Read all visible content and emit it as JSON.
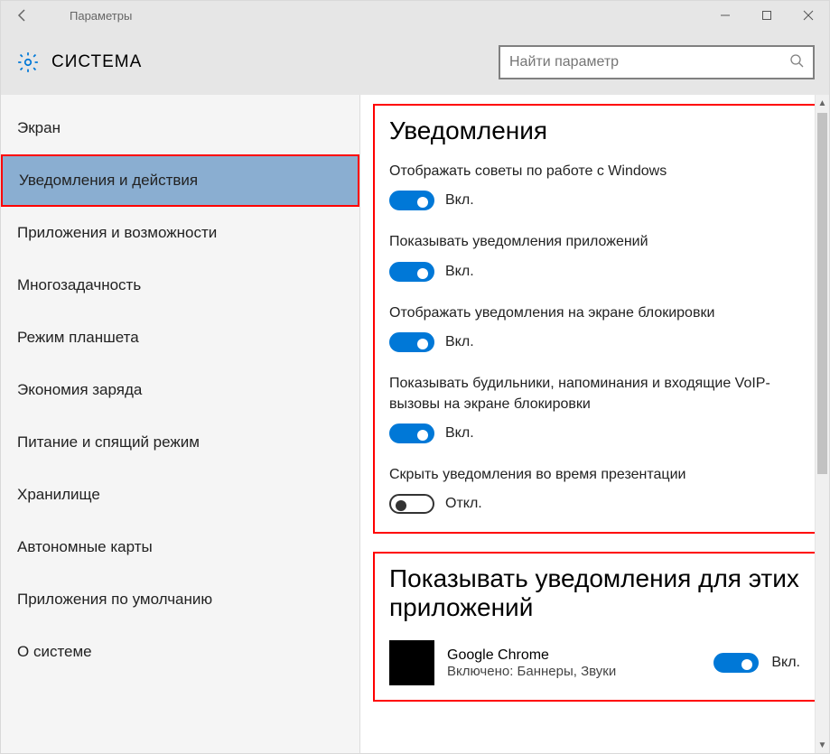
{
  "window": {
    "title": "Параметры"
  },
  "header": {
    "title": "СИСТЕМА",
    "search_placeholder": "Найти параметр"
  },
  "sidebar": {
    "items": [
      {
        "label": "Экран",
        "selected": false
      },
      {
        "label": "Уведомления и действия",
        "selected": true
      },
      {
        "label": "Приложения и возможности",
        "selected": false
      },
      {
        "label": "Многозадачность",
        "selected": false
      },
      {
        "label": "Режим планшета",
        "selected": false
      },
      {
        "label": "Экономия заряда",
        "selected": false
      },
      {
        "label": "Питание и спящий режим",
        "selected": false
      },
      {
        "label": "Хранилище",
        "selected": false
      },
      {
        "label": "Автономные карты",
        "selected": false
      },
      {
        "label": "Приложения по умолчанию",
        "selected": false
      },
      {
        "label": "О системе",
        "selected": false
      }
    ]
  },
  "main": {
    "section1_title": "Уведомления",
    "toggle_on_text": "Вкл.",
    "toggle_off_text": "Откл.",
    "settings": [
      {
        "label": "Отображать советы по работе с Windows",
        "on": true
      },
      {
        "label": "Показывать уведомления приложений",
        "on": true
      },
      {
        "label": "Отображать уведомления на экране блокировки",
        "on": true
      },
      {
        "label": "Показывать будильники, напоминания и входящие VoIP-вызовы на экране блокировки",
        "on": true
      },
      {
        "label": "Скрыть уведомления во время презентации",
        "on": false
      }
    ],
    "section2_title": "Показывать уведомления для этих приложений",
    "apps": [
      {
        "name": "Google Chrome",
        "sub": "Включено: Баннеры, Звуки",
        "on": true
      }
    ]
  }
}
